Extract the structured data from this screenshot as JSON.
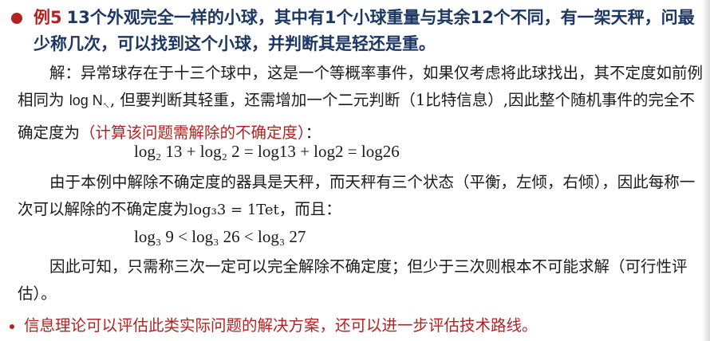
{
  "heading": {
    "label": "例5",
    "text": "13个外观完全一样的小球，其中有1个小球重量与其余12个不同，有一架天秤，问最少称几次，可以找到这个小球，并判断其是轻还是重。"
  },
  "para1": {
    "part1": "解：异常球存在于十三个球中，这是一个等概率事件，如果仅考虑将此球找出，其不定度如前例相同为",
    "math": "log N",
    "part2": ", 但要判断其轻重，还需增加一个二元判断（1比特信息）,因此整个随机事件的完全不确定度为",
    "highlight": "（计算该问题需解除的不确定度）",
    "end": "："
  },
  "formula1": "log₂ 13 + log₂ 2 = log13 + log2 = log26",
  "para2": {
    "part1": "由于本例中解除不确定度的器具是天秤，而天秤有三个状态（平衡，左倾，右倾），因此每称一次可以解除的不确定度为",
    "math": "log₃3 = 1Tet",
    "end": "，而且："
  },
  "formula2": "log₃ 9  <  log₃ 26 <  log₃ 27",
  "para3": {
    "text": "因此可知，只需称三次一定可以完全解除不确定度；但少于三次则根本不可能求解（可行性评估）。"
  },
  "conclusion": {
    "text": "信息理论可以评估此类实际问题的解决方案，还可以进一步评估技术路线。"
  },
  "colors": {
    "accent": "#b22222",
    "heading": "#1c3764",
    "body": "#1a1a1a"
  }
}
